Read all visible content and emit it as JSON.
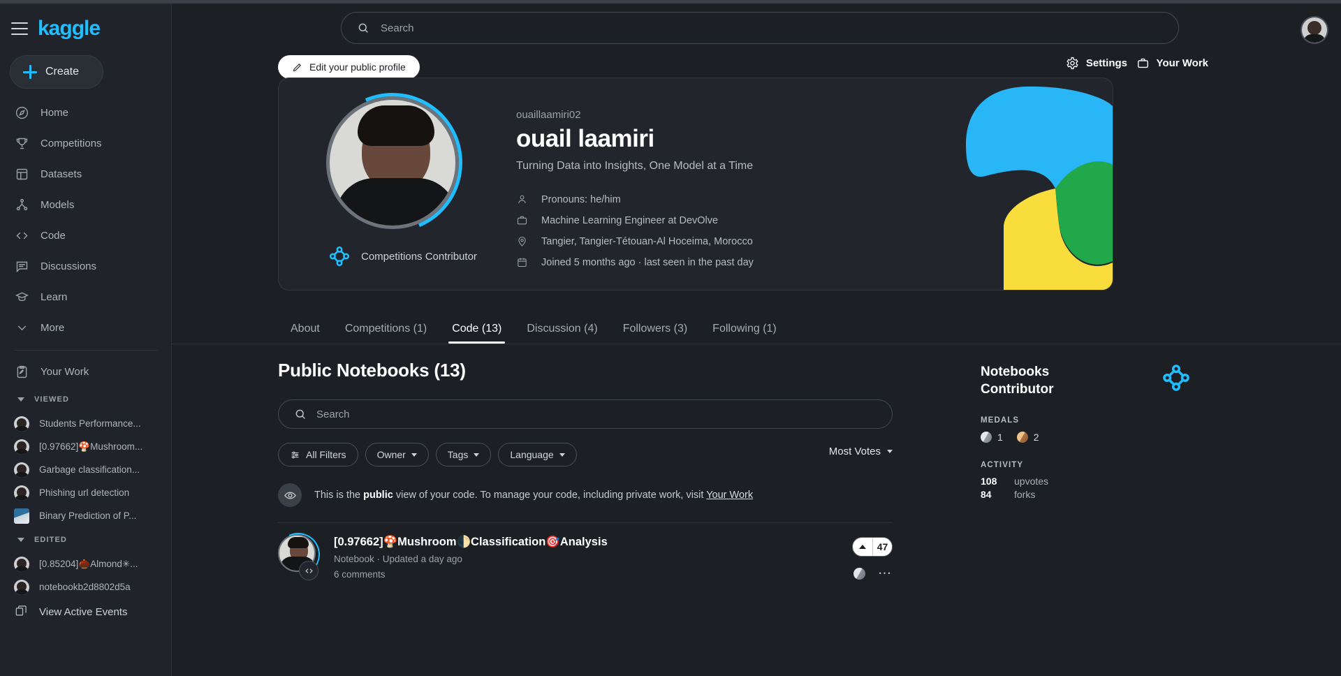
{
  "brand": {
    "logo_text": "kaggle"
  },
  "sidebar": {
    "create_label": "Create",
    "nav": [
      {
        "label": "Home",
        "icon": "compass-icon"
      },
      {
        "label": "Competitions",
        "icon": "trophy-icon"
      },
      {
        "label": "Datasets",
        "icon": "table-icon"
      },
      {
        "label": "Models",
        "icon": "models-icon"
      },
      {
        "label": "Code",
        "icon": "code-icon"
      },
      {
        "label": "Discussions",
        "icon": "discussion-icon"
      },
      {
        "label": "Learn",
        "icon": "graduation-cap-icon"
      },
      {
        "label": "More",
        "icon": "chevron-down-icon"
      }
    ],
    "your_work_label": "Your Work",
    "viewed_header": "VIEWED",
    "viewed_items": [
      {
        "label": "Students Performance...",
        "avatar": "person"
      },
      {
        "label": "[0.97662]🍄Mushroom...",
        "avatar": "person"
      },
      {
        "label": "Garbage classification...",
        "avatar": "person"
      },
      {
        "label": "Phishing url detection",
        "avatar": "person"
      },
      {
        "label": "Binary Prediction of P...",
        "avatar": "dataset"
      }
    ],
    "edited_header": "EDITED",
    "edited_items": [
      {
        "label": "[0.85204]🌰Almond✳...",
        "avatar": "person"
      },
      {
        "label": "notebookb2d8802d5a",
        "avatar": "person"
      }
    ],
    "view_active_events_label": "View Active Events"
  },
  "topbar": {
    "search_placeholder": "Search"
  },
  "actions": {
    "edit_profile_label": "Edit your public profile",
    "settings_label": "Settings",
    "your_work_label": "Your Work"
  },
  "profile": {
    "username": "ouaillaamiri02",
    "display_name": "ouail laamiri",
    "tagline": "Turning Data into Insights, One Model at a Time",
    "meta": [
      {
        "icon": "person-icon",
        "text": "Pronouns: he/him"
      },
      {
        "icon": "briefcase-icon",
        "text": "Machine Learning Engineer at DevOlve"
      },
      {
        "icon": "location-pin-icon",
        "text": "Tangier, Tangier-Tétouan-Al Hoceima, Morocco"
      },
      {
        "icon": "calendar-icon",
        "text": "Joined 5 months ago · last seen in the past day"
      }
    ],
    "tier_badge": "Competitions Contributor",
    "tier_color": "#20beff",
    "blob_colors": {
      "blue": "#29b6f6",
      "green": "#20a84a",
      "yellow": "#f9dd3c"
    }
  },
  "tabs": [
    {
      "label": "About",
      "active": false
    },
    {
      "label": "Competitions (1)",
      "active": false
    },
    {
      "label": "Code (13)",
      "active": true
    },
    {
      "label": "Discussion (4)",
      "active": false
    },
    {
      "label": "Followers (3)",
      "active": false
    },
    {
      "label": "Following (1)",
      "active": false
    }
  ],
  "code_section": {
    "title": "Public Notebooks (13)",
    "search_placeholder": "Search",
    "filters": [
      {
        "label": "All Filters",
        "icon": "filter-icon",
        "has_chevron": false
      },
      {
        "label": "Owner",
        "icon": "",
        "has_chevron": true
      },
      {
        "label": "Tags",
        "icon": "",
        "has_chevron": true
      },
      {
        "label": "Language",
        "icon": "",
        "has_chevron": true
      }
    ],
    "sort_label": "Most Votes",
    "notice": {
      "before": "This is the ",
      "bold": "public",
      "middle": " view of your code. To manage your code, including private work, visit ",
      "link": "Your Work"
    },
    "notebooks": [
      {
        "title": "[0.97662]🍄Mushroom🌓Classification🎯Analysis",
        "subtitle": "Notebook · Updated a day ago",
        "comments": "6 comments",
        "votes": "47"
      }
    ]
  },
  "rail": {
    "tier_title": "Notebooks\nContributor",
    "tier_title_line1": "Notebooks",
    "tier_title_line2": "Contributor",
    "medals_label": "MEDALS",
    "medals": [
      {
        "type": "silver",
        "count": "1"
      },
      {
        "type": "bronze",
        "count": "2"
      }
    ],
    "activity_label": "ACTIVITY",
    "activity": [
      {
        "value": "108",
        "label": "upvotes"
      },
      {
        "value": "84",
        "label": "forks"
      }
    ]
  }
}
